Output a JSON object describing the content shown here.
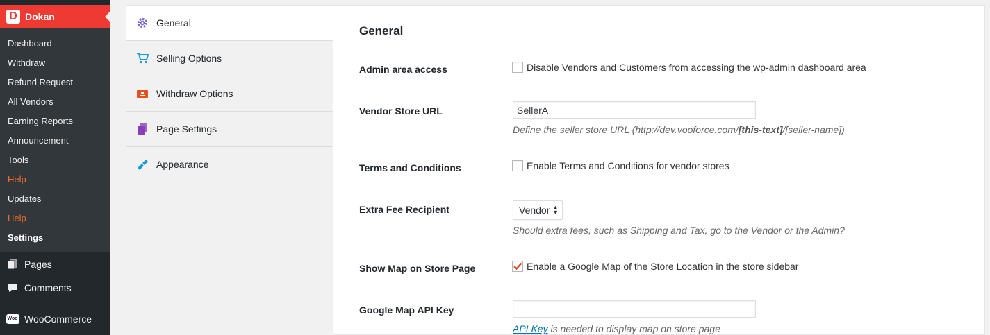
{
  "sidebar": {
    "brand": {
      "title": "Dokan",
      "logo_letter": "D"
    },
    "submenu": [
      "Dashboard",
      "Withdraw",
      "Refund Request",
      "All Vendors",
      "Earning Reports",
      "Announcement",
      "Tools",
      "Help",
      "Updates",
      "Help",
      "Settings"
    ],
    "main": [
      {
        "label": "Pages",
        "icon": "pages-icon"
      },
      {
        "label": "Comments",
        "icon": "comments-icon"
      },
      {
        "label": "WooCommerce",
        "icon": "woocommerce-icon",
        "badge": "Woo"
      }
    ]
  },
  "tabs": [
    {
      "label": "General",
      "icon": "gear-icon",
      "active": true
    },
    {
      "label": "Selling Options",
      "icon": "cart-icon"
    },
    {
      "label": "Withdraw Options",
      "icon": "withdraw-icon"
    },
    {
      "label": "Page Settings",
      "icon": "pages-icon"
    },
    {
      "label": "Appearance",
      "icon": "brush-icon"
    }
  ],
  "form": {
    "title": "General",
    "admin_access": {
      "label": "Admin area access",
      "checkbox_label": "Disable Vendors and Customers from accessing the wp-admin dashboard area",
      "checked": false
    },
    "store_url": {
      "label": "Vendor Store URL",
      "value": "SellerA",
      "desc_prefix": "Define the seller store URL (http://dev.vooforce.com/",
      "desc_bold": "[this-text]",
      "desc_suffix": "/[seller-name])"
    },
    "terms": {
      "label": "Terms and Conditions",
      "checkbox_label": "Enable Terms and Conditions for vendor stores",
      "checked": false
    },
    "extra_fee": {
      "label": "Extra Fee Recipient",
      "selected": "Vendor",
      "desc": "Should extra fees, such as Shipping and Tax, go to the Vendor or the Admin?"
    },
    "show_map": {
      "label": "Show Map on Store Page",
      "checkbox_label": "Enable a Google Map of the Store Location in the store sidebar",
      "checked": true
    },
    "map_key": {
      "label": "Google Map API Key",
      "value": "",
      "link_text": "API Key",
      "desc_rest": " is needed to display map on store page"
    }
  },
  "colors": {
    "dokan_red": "#ee3a32",
    "help_orange": "#f56e28",
    "link_blue": "#0073aa",
    "check_red": "#d54e21"
  }
}
